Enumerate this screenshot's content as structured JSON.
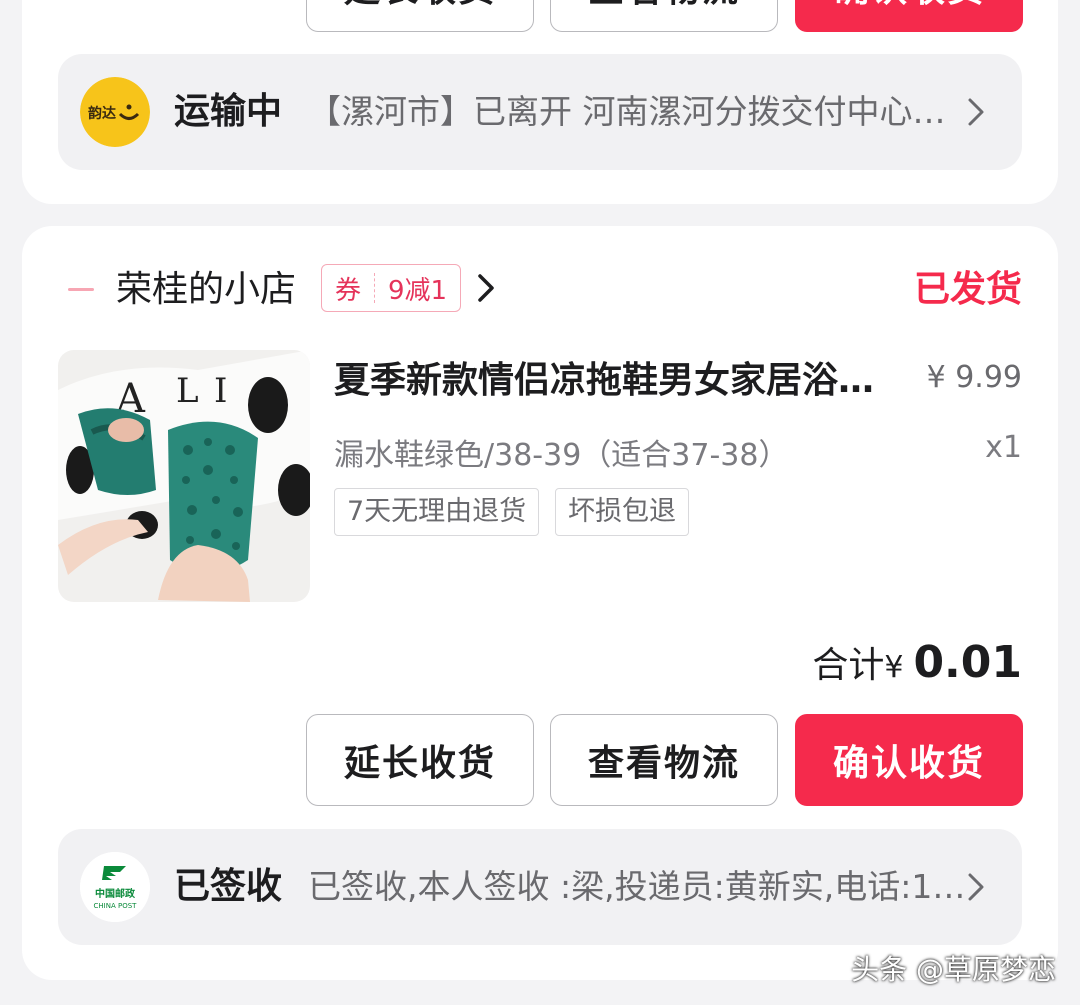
{
  "top_order": {
    "buttons": {
      "extend": "延长收货",
      "logistics": "查看物流",
      "confirm": "确认收货"
    },
    "logistics": {
      "carrier_logo_text": "韵达",
      "status": "运输中",
      "detail": "【漯河市】已离开 河南漯河分拨交付中心；发往 河南郑州分拨交付中心"
    }
  },
  "order": {
    "shop": {
      "name": "荣桂的小店",
      "coupon_label": "券",
      "coupon_value": "9减1",
      "status": "已发货"
    },
    "product": {
      "title": "夏季新款情侣凉拖鞋男女家居浴室漏水防滑拖鞋",
      "price": "¥ 9.99",
      "sku": "漏水鞋绿色/38-39（适合37-38）",
      "qty": "x1",
      "tags": [
        "7天无理由退货",
        "坏损包退"
      ]
    },
    "total": {
      "label": "合计",
      "currency": "¥",
      "amount": "0.01"
    },
    "buttons": {
      "extend": "延长收货",
      "logistics": "查看物流",
      "confirm": "确认收货"
    },
    "logistics": {
      "carrier_logo_text": "中国邮政",
      "carrier_logo_sub": "CHINA POST",
      "status": "已签收",
      "detail": "已签收,本人签收 :梁,投递员:黄新实,电话:1……"
    }
  },
  "watermark": "头条 @草原梦恋",
  "colors": {
    "accent": "#f52a4c",
    "yunda": "#f7c41a",
    "post_green": "#0a8a3a"
  }
}
